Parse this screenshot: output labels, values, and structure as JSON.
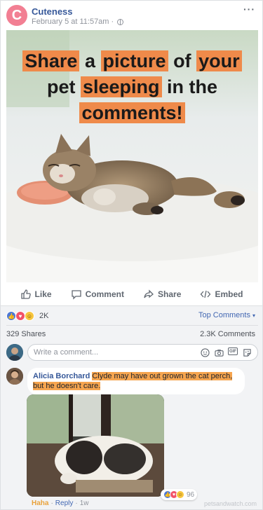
{
  "post": {
    "page_name": "Cuteness",
    "avatar_letter": "C",
    "timestamp": "February 5 at 11:57am",
    "separator": "·",
    "more_icon": "more-dots-icon"
  },
  "image": {
    "headline_words": [
      "Share",
      "a",
      "picture",
      "of",
      "your",
      "pet",
      "sleeping",
      "in",
      "the",
      "comments!"
    ]
  },
  "actions": {
    "like": "Like",
    "comment": "Comment",
    "share": "Share",
    "embed": "Embed"
  },
  "reactions": {
    "count": "2K",
    "top_comments": "Top Comments",
    "caret": "▾"
  },
  "counts": {
    "shares": "329 Shares",
    "comments": "2.3K Comments"
  },
  "compose": {
    "placeholder": "Write a comment..."
  },
  "comment": {
    "author": "Alicia Borchard",
    "text": "Clyde may have out grown the cat perch, but he doesn't care.",
    "reaction_count": "96",
    "haha": "Haha",
    "reply": "Reply",
    "sep": "·",
    "time": "1w"
  },
  "watermark": "petsandwatch.com",
  "colors": {
    "brand_blue": "#4267b2",
    "highlight_orange": "#ef8a4a",
    "avatar_pink": "#f27f93"
  }
}
